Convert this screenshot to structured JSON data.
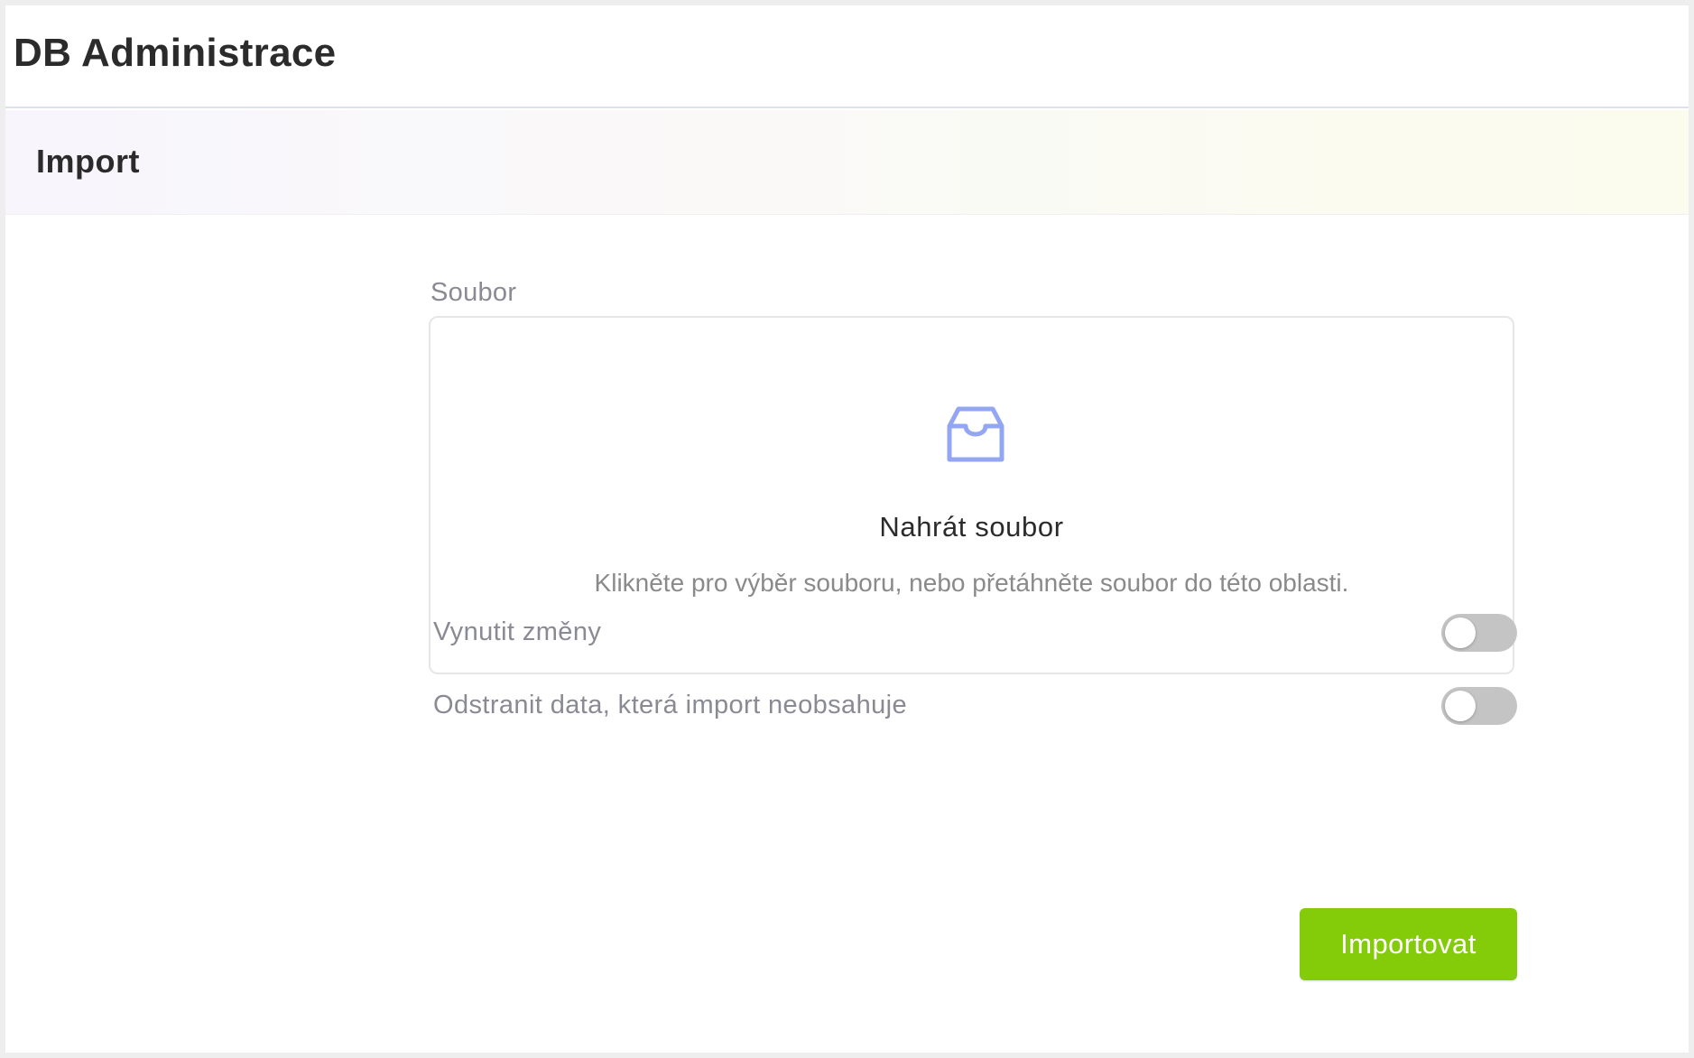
{
  "app": {
    "title": "DB Administrace"
  },
  "section": {
    "title": "Import"
  },
  "form": {
    "file_label": "Soubor",
    "dropzone": {
      "icon": "inbox-icon",
      "title": "Nahrát soubor",
      "hint": "Klikněte pro výběr souboru, nebo přetáhněte soubor do této oblasti."
    },
    "switches": [
      {
        "label": "Vynutit změny",
        "checked": false
      },
      {
        "label": "Odstranit data, která import neobsahuje",
        "checked": false
      }
    ],
    "submit_label": "Importovat"
  },
  "colors": {
    "accent_green": "#84cc0a",
    "icon_blue": "#93a6f3",
    "switch_off": "#c4c4c4"
  }
}
